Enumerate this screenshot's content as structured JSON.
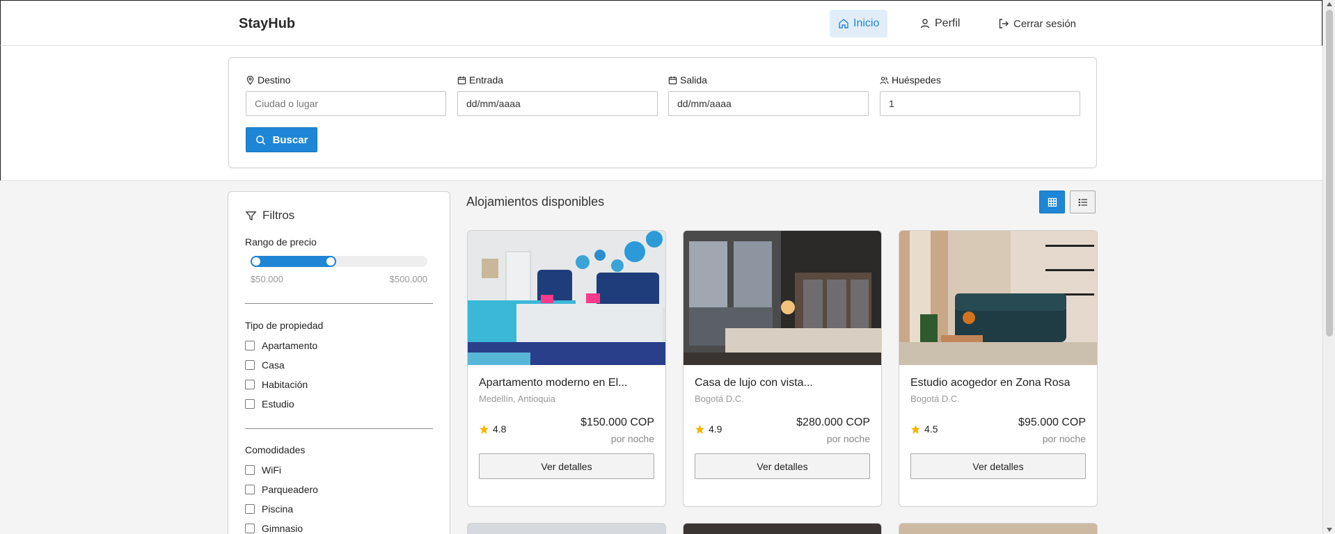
{
  "header": {
    "brand": "StayHub",
    "nav": [
      {
        "label": "Inicio",
        "icon": "home-icon",
        "active": true
      },
      {
        "label": "Perfil",
        "icon": "user-icon",
        "active": false
      },
      {
        "label": "Cerrar sesión",
        "icon": "logout-icon",
        "active": false
      }
    ]
  },
  "search": {
    "destination": {
      "label": "Destino",
      "placeholder": "Ciudad o lugar",
      "value": ""
    },
    "checkin": {
      "label": "Entrada",
      "value": "dd/mm/aaaa"
    },
    "checkout": {
      "label": "Salida",
      "value": "dd/mm/aaaa"
    },
    "guests": {
      "label": "Huéspedes",
      "value": "1"
    },
    "button": "Buscar"
  },
  "filters": {
    "title": "Filtros",
    "price_range": {
      "label": "Rango de precio",
      "min_label": "$50.000",
      "max_label": "$500.000",
      "selected_fraction": 0.45
    },
    "property_type": {
      "label": "Tipo de propiedad",
      "options": [
        "Apartamento",
        "Casa",
        "Habitación",
        "Estudio"
      ]
    },
    "amenities": {
      "label": "Comodidades",
      "options": [
        "WiFi",
        "Parqueadero",
        "Piscina",
        "Gimnasio"
      ]
    }
  },
  "listings": {
    "title": "Alojamientos disponibles",
    "view_modes": [
      "grid",
      "list"
    ],
    "active_view": "grid",
    "cards": [
      {
        "title": "Apartamento moderno en El...",
        "location": "Medellín, Antioquia",
        "rating": "4.8",
        "price": "$150.000 COP",
        "per_night": "por noche",
        "button": "Ver detalles"
      },
      {
        "title": "Casa de lujo con vista...",
        "location": "Bogotá D.C.",
        "rating": "4.9",
        "price": "$280.000 COP",
        "per_night": "por noche",
        "button": "Ver detalles"
      },
      {
        "title": "Estudio acogedor en Zona Rosa",
        "location": "Bogotá D.C.",
        "rating": "4.5",
        "price": "$95.000 COP",
        "per_night": "por noche",
        "button": "Ver detalles"
      }
    ]
  },
  "colors": {
    "accent": "#1f86d6",
    "star": "#f4b400"
  }
}
